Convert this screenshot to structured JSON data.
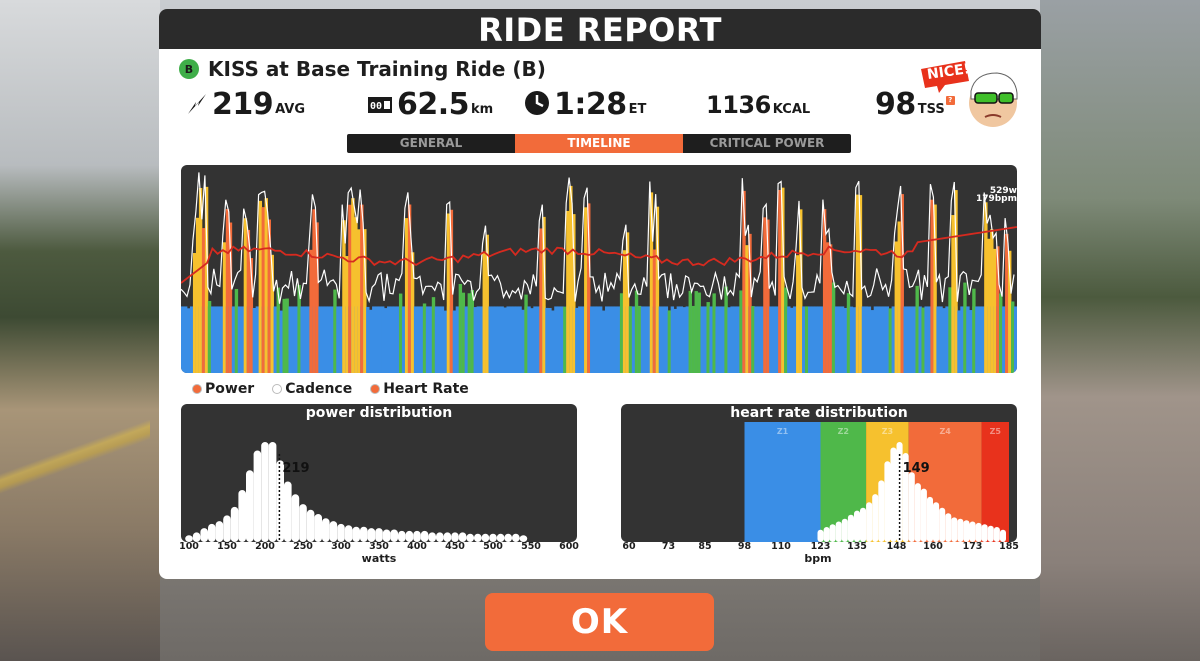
{
  "report": {
    "title": "RIDE REPORT",
    "category": "B",
    "ride_name": "KISS at Base Training Ride (B)"
  },
  "stats": {
    "power": {
      "value": "219",
      "unit": "AVG"
    },
    "distance": {
      "value": "62.5",
      "unit": "km"
    },
    "time": {
      "value": "1:28",
      "unit": "ET"
    },
    "calories": {
      "value": "1136",
      "unit": "KCAL"
    },
    "tss": {
      "value": "98",
      "unit": "TSS",
      "help": "?"
    }
  },
  "mascot": {
    "bubble": "NICE!"
  },
  "tabs": [
    {
      "label": "GENERAL",
      "active": false
    },
    {
      "label": "TIMELINE",
      "active": true
    },
    {
      "label": "CRITICAL POWER",
      "active": false
    }
  ],
  "timeline": {
    "max_power_label": "529w",
    "max_hr_label": "179bpm"
  },
  "legend": [
    {
      "label": "Power",
      "color": "#f26b3a"
    },
    {
      "label": "Cadence",
      "color": "#ffffff"
    },
    {
      "label": "Heart Rate",
      "color": "#f26b3a"
    }
  ],
  "colors": {
    "accent": "#f26b3a",
    "zone1": "#3a8ee6",
    "zone2": "#4fb84a",
    "zone3": "#f6c12e",
    "zone4": "#f26b3a",
    "zone5": "#e8321c",
    "hr_line": "#d62a1f",
    "chart_bg": "#333333"
  },
  "chart_data": [
    {
      "type": "bar",
      "title": "power distribution",
      "xlabel": "watts",
      "x_ticks": [
        "100",
        "150",
        "200",
        "250",
        "300",
        "350",
        "400",
        "450",
        "500",
        "550",
        "600"
      ],
      "x": [
        100,
        110,
        120,
        130,
        140,
        150,
        160,
        170,
        180,
        190,
        200,
        210,
        220,
        230,
        240,
        250,
        260,
        270,
        280,
        290,
        300,
        310,
        320,
        330,
        340,
        350,
        360,
        370,
        380,
        390,
        400,
        410,
        420,
        430,
        440,
        450,
        460,
        470,
        480,
        490,
        500,
        510,
        520,
        530,
        540
      ],
      "values": [
        2,
        4,
        7,
        10,
        12,
        16,
        22,
        34,
        48,
        62,
        68,
        68,
        55,
        40,
        31,
        24,
        20,
        17,
        14,
        12,
        10,
        9,
        8,
        8,
        7,
        7,
        6,
        6,
        5,
        5,
        5,
        5,
        4,
        4,
        4,
        4,
        4,
        3,
        3,
        3,
        3,
        3,
        3,
        3,
        2
      ],
      "marker": {
        "value": 219,
        "label": "219"
      },
      "xlim": [
        100,
        600
      ]
    },
    {
      "type": "bar",
      "title": "heart rate distribution",
      "xlabel": "bpm",
      "x_ticks": [
        "60",
        "73",
        "85",
        "98",
        "110",
        "123",
        "135",
        "148",
        "160",
        "173",
        "185"
      ],
      "zones": [
        {
          "label": "Z1",
          "from": 98,
          "to": 123
        },
        {
          "label": "Z2",
          "from": 123,
          "to": 138
        },
        {
          "label": "Z3",
          "from": 138,
          "to": 152
        },
        {
          "label": "Z4",
          "from": 152,
          "to": 176
        },
        {
          "label": "Z5",
          "from": 176,
          "to": 185
        }
      ],
      "x": [
        123,
        125,
        127,
        129,
        131,
        133,
        135,
        137,
        139,
        141,
        143,
        145,
        147,
        149,
        151,
        153,
        155,
        157,
        159,
        161,
        163,
        165,
        167,
        169,
        171,
        173,
        175,
        177,
        179,
        181,
        183
      ],
      "values": [
        6,
        8,
        10,
        12,
        14,
        17,
        20,
        22,
        26,
        32,
        42,
        56,
        66,
        70,
        62,
        48,
        40,
        36,
        30,
        26,
        22,
        18,
        15,
        14,
        13,
        12,
        11,
        10,
        9,
        8,
        6
      ],
      "marker": {
        "value": 149,
        "label": "149"
      },
      "xlim": [
        60,
        185
      ]
    }
  ]
}
